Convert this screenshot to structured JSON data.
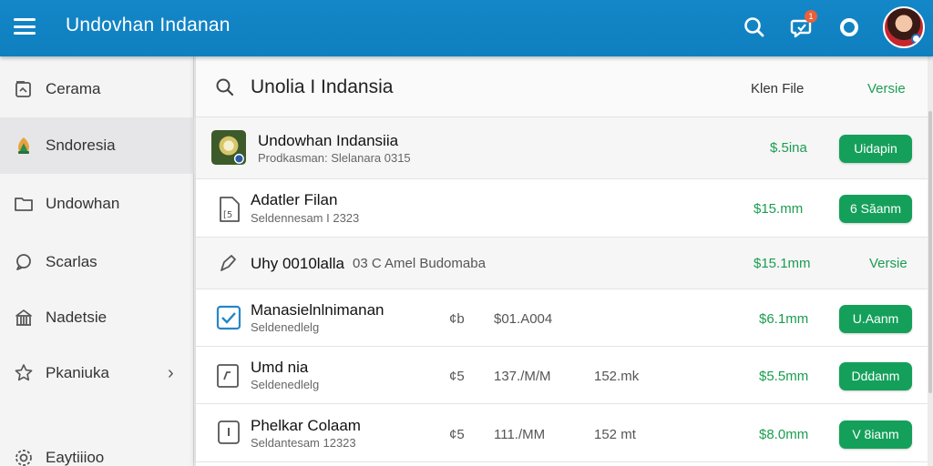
{
  "header": {
    "title": "Undovhan Indanan",
    "notification_count": "1",
    "icons": [
      "menu-icon",
      "search-icon",
      "chat-bubble-icon",
      "circle-icon",
      "avatar"
    ]
  },
  "sidebar": {
    "items": [
      {
        "label": "Cerama",
        "icon": "gallery-icon"
      },
      {
        "label": "Sndoresia",
        "icon": "leaf-icon"
      },
      {
        "label": "Undowhan",
        "icon": "folder-icon"
      },
      {
        "label": "Scarlas",
        "icon": "chat-icon"
      },
      {
        "label": "Nadetsie",
        "icon": "building-icon"
      },
      {
        "label": "Pkaniuka",
        "icon": "star-icon"
      },
      {
        "label": "Eaytiiioo",
        "icon": "gear-icon"
      }
    ]
  },
  "toolbar": {
    "search_text": "Unolia I Indansia",
    "file_link": "Klen File",
    "version_link": "Versie"
  },
  "rows": [
    {
      "title": "Undowhan Indansiia",
      "subtitle": "Prodkasman: Slelanara 0315",
      "price": "$.5ina",
      "action": "Uidapin",
      "icon": "app-thumbnail-icon"
    },
    {
      "title": "Adatler Filan",
      "subtitle": "Seldennesam I 2323",
      "price": "$15.mm",
      "action": "6 Săanm",
      "icon": "document-icon"
    },
    {
      "title": "Uhy 0010lalla",
      "subtitle_inline": "03 C Amel Budomaba",
      "price": "$15.1mm",
      "action_link": "Versie",
      "icon": "edit-icon"
    },
    {
      "title": "Manasielnlnimanan",
      "subtitle": "Seldenedlelg",
      "c1": "¢b",
      "c2": "$01.A004",
      "price": "$6.1mm",
      "action": "U.Aanm",
      "icon": "checkbox-icon"
    },
    {
      "title": "Umd nia",
      "subtitle": "Seldenedlelg",
      "c1": "¢5",
      "c2": "137./M/M",
      "c3": "152.mk",
      "price": "$5.5mm",
      "action": "Dddanm",
      "icon": "pencil-doc-icon"
    },
    {
      "title": "Phelkar Colaam",
      "subtitle": "Seldantesam 12323",
      "c1": "¢5",
      "c2": "111./MM",
      "c3": "152 mt",
      "price": "$8.0mm",
      "action": "V 8ianm",
      "icon": "tablet-icon"
    }
  ],
  "colors": {
    "appbar": "#1387c8",
    "accent_green": "#14a05a",
    "price_green": "#1a9d4f",
    "badge": "#e8603a"
  }
}
